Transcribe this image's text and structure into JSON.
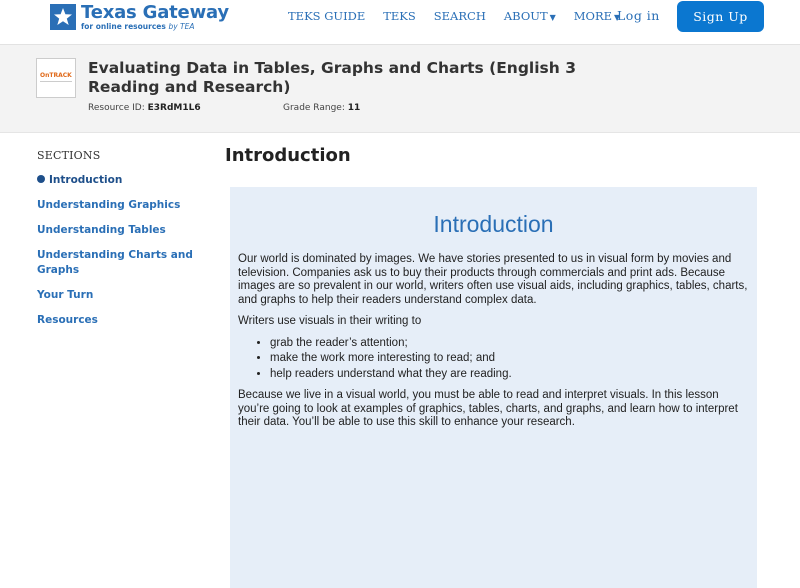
{
  "header": {
    "logo_name": "Texas Gateway",
    "logo_tag": "for online resources",
    "logo_tag_by": "by TEA",
    "nav": [
      {
        "label": "TEKS GUIDE",
        "dropdown": false
      },
      {
        "label": "TEKS",
        "dropdown": false
      },
      {
        "label": "SEARCH",
        "dropdown": false
      },
      {
        "label": "ABOUT",
        "dropdown": true
      },
      {
        "label": "MORE",
        "dropdown": true
      }
    ],
    "login_label": "Log in",
    "signup_label": "Sign Up",
    "accent_color": "#2a6fb6",
    "signup_color": "#0b77d0"
  },
  "resource": {
    "thumb_text": "OnTRACK",
    "title": "Evaluating Data in Tables, Graphs and Charts (English 3 Reading and Research)",
    "id_label": "Resource ID:",
    "id_value": "E3RdM1L6",
    "grade_label": "Grade Range:",
    "grade_value": "11"
  },
  "sidebar": {
    "heading": "SECTIONS",
    "items": [
      {
        "label": "Introduction",
        "active": true
      },
      {
        "label": "Understanding Graphics",
        "active": false
      },
      {
        "label": "Understanding Tables",
        "active": false
      },
      {
        "label": "Understanding Charts and Graphs",
        "active": false
      },
      {
        "label": "Your Turn",
        "active": false
      },
      {
        "label": "Resources",
        "active": false
      }
    ]
  },
  "main": {
    "heading": "Introduction",
    "panel_title": "Introduction",
    "para1": "Our world is dominated by images. We have stories presented to us in visual form by movies and television. Companies ask us to buy their products through commercials and print ads. Because images are so prevalent in our world, writers often use visual aids, including graphics, tables, charts, and graphs to help their readers understand complex data.",
    "para2": "Writers use visuals in their writing to",
    "bullets": [
      "grab the reader’s attention;",
      "make the work more interesting to read; and",
      "help readers understand what they are reading."
    ],
    "para3": "Because we live in a visual world, you must be able to read and interpret visuals. In this lesson you’re going to look at examples of graphics, tables, charts, and graphs, and learn how to interpret their data. You’ll be able to use this skill to enhance your research.",
    "panel_color": "#e6eef8"
  }
}
